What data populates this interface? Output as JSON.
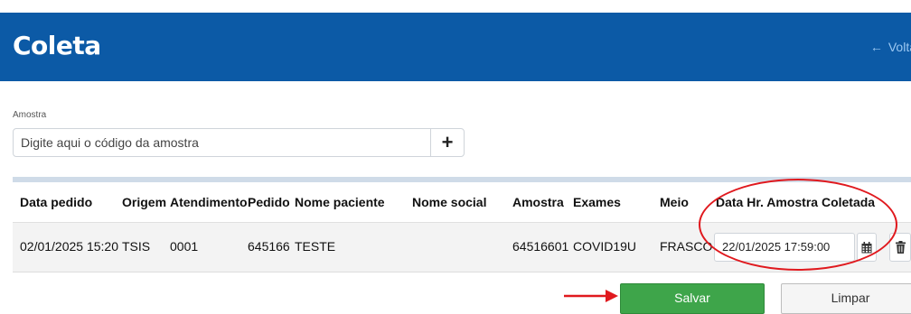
{
  "header": {
    "title": "Coleta",
    "back_label": "Volta"
  },
  "colors": {
    "header_bg": "#0c5aa6",
    "salvar_bg": "#3ea54a",
    "annotation": "#e0191e"
  },
  "amostra": {
    "label": "Amostra",
    "placeholder": "Digite aqui o código da amostra",
    "add_icon": "plus-icon"
  },
  "table": {
    "headers": {
      "data_pedido": "Data pedido",
      "origem": "Origem",
      "atendimento": "Atendimento",
      "pedido": "Pedido",
      "nome_paciente": "Nome paciente",
      "nome_social": "Nome social",
      "amostra": "Amostra",
      "exames": "Exames",
      "meio": "Meio",
      "data_hr": "Data Hr. Amostra Coletada"
    },
    "row": {
      "data_pedido": "02/01/2025 15:20",
      "origem": "TSIS",
      "atendimento": "0001",
      "pedido": "645166",
      "nome_paciente": "TESTE",
      "nome_social": "",
      "amostra": "64516601",
      "exames": "COVID19U",
      "meio": "FRASCO",
      "data_hr": "22/01/2025 17:59:00"
    }
  },
  "actions": {
    "salvar": "Salvar",
    "limpar": "Limpar"
  }
}
